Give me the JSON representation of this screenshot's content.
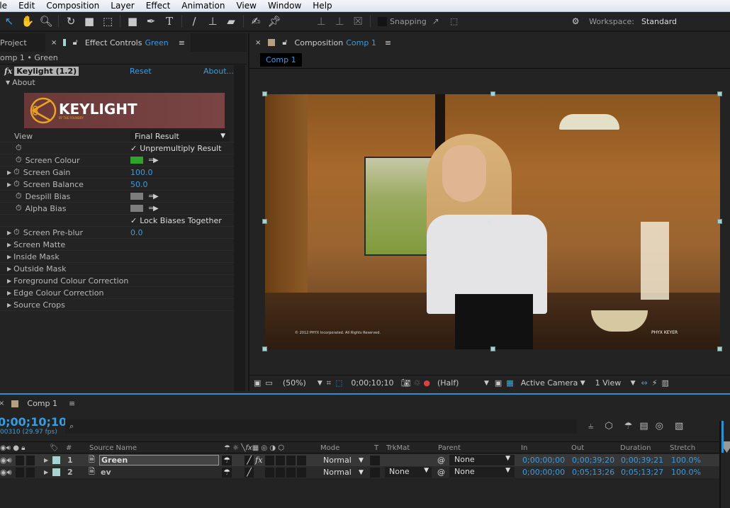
{
  "menubar": {
    "items": [
      "ile",
      "Edit",
      "Composition",
      "Layer",
      "Effect",
      "Animation",
      "View",
      "Window",
      "Help"
    ]
  },
  "toolbar": {
    "tools": [
      "selection-tool",
      "hand-tool",
      "zoom-tool",
      "rotate-tool",
      "camera-tool",
      "pan-behind-tool",
      "rectangle-tool",
      "pen-tool",
      "type-tool",
      "brush-tool",
      "clone-stamp-tool",
      "eraser-tool",
      "roto-brush-tool",
      "puppet-pin-tool"
    ],
    "axis_tools": [
      "local-axis",
      "world-axis",
      "view-axis"
    ],
    "snapping_label": "Snapping",
    "workspace_label": "Workspace:",
    "workspace_value": "Standard"
  },
  "left_panel": {
    "tab_project": "Project",
    "tab_effect_controls": "Effect Controls",
    "tab_effect_controls_layer": "Green",
    "breadcrumb": "omp 1 • Green",
    "effect": {
      "fx_label": "fx",
      "name": "Keylight (1.2)",
      "reset": "Reset",
      "about": "About...",
      "about_section": "About",
      "logo_text": "KEYLIGHT",
      "logo_subtext": "BY THE FOUNDRY"
    },
    "params": [
      {
        "label": "View",
        "value": "Final Result",
        "type": "dropdown"
      },
      {
        "label": "",
        "value": "Unpremultiply Result",
        "type": "checkbox",
        "checked": true
      },
      {
        "label": "Screen Colour",
        "value": "",
        "type": "color",
        "color": "#2fa32b"
      },
      {
        "label": "Screen Gain",
        "value": "100.0",
        "type": "number"
      },
      {
        "label": "Screen Balance",
        "value": "50.0",
        "type": "number"
      },
      {
        "label": "Despill Bias",
        "value": "",
        "type": "color",
        "color": "#7d7d7d"
      },
      {
        "label": "Alpha Bias",
        "value": "",
        "type": "color",
        "color": "#7d7d7d"
      },
      {
        "label": "",
        "value": "Lock Biases Together",
        "type": "checkbox",
        "checked": true
      },
      {
        "label": "Screen Pre-blur",
        "value": "0.0",
        "type": "number"
      }
    ],
    "groups": [
      "Screen Matte",
      "Inside Mask",
      "Outside Mask",
      "Foreground Colour Correction",
      "Edge Colour Correction",
      "Source Crops"
    ]
  },
  "comp_panel": {
    "tab_label": "Composition",
    "tab_comp": "Comp 1",
    "comp_button": "Comp 1",
    "footer": {
      "zoom": "(50%)",
      "timecode": "0;00;10;10",
      "resolution": "(Half)",
      "camera": "Active Camera",
      "views": "1 View"
    },
    "viewer_text": {
      "copyright": "© 2012 PHYX Incorporated.  All Rights Reserved.",
      "watermark": "PHYX KEYER"
    }
  },
  "timeline": {
    "tab_label": "Comp 1",
    "current_time": "0;00;10;10",
    "frame_info": "00310 (29.97 fps)",
    "search_placeholder": "",
    "columns": {
      "num": "#",
      "source": "Source Name",
      "mode": "Mode",
      "t": "T",
      "trkmat": "TrkMat",
      "parent": "Parent",
      "in": "In",
      "out": "Out",
      "duration": "Duration",
      "stretch": "Stretch"
    },
    "layers": [
      {
        "num": "1",
        "name": "Green",
        "mode": "Normal",
        "trkmat": "",
        "parent": "None",
        "in": "0;00;00;00",
        "out": "0;00;39;20",
        "duration": "0;00;39;21",
        "stretch": "100.0%",
        "fx": "fx",
        "selected": true
      },
      {
        "num": "2",
        "name": "ev",
        "mode": "Normal",
        "trkmat": "None",
        "parent": "None",
        "in": "0;00;00;00",
        "out": "0;05;13;26",
        "duration": "0;05;13;27",
        "stretch": "100.0%",
        "fx": "",
        "selected": false
      }
    ]
  },
  "colors": {
    "accent": "#3a9ce0",
    "label_aqua": "#a7d2cf",
    "label_tan": "#b59f7f",
    "screen_green": "#2fa32b"
  }
}
